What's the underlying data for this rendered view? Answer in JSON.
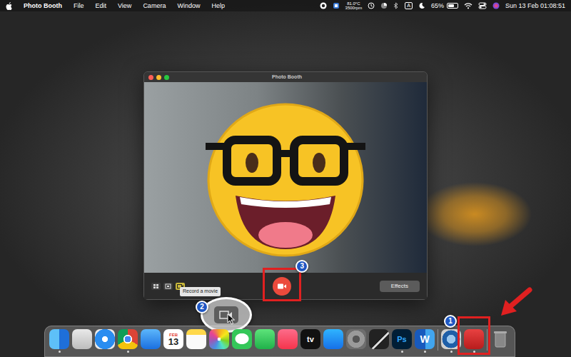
{
  "menubar": {
    "app": "Photo Booth",
    "menus": [
      "File",
      "Edit",
      "View",
      "Camera",
      "Window",
      "Help"
    ],
    "sensor": {
      "temp": "81.0°C",
      "fan": "3500rpm"
    },
    "input_source": "A",
    "battery": {
      "reading": "65%",
      "level": 0.65
    },
    "clock": "Sun 13 Feb  01:08:51"
  },
  "window": {
    "title": "Photo Booth",
    "view_modes": [
      {
        "kind": "grid",
        "selected": false
      },
      {
        "kind": "still",
        "selected": false
      },
      {
        "kind": "movie",
        "selected": true
      }
    ],
    "tooltip": "Record a movie",
    "effects_button": "Effects"
  },
  "dock": {
    "items": [
      {
        "running": true,
        "texts": []
      },
      {
        "running": false,
        "texts": []
      },
      {
        "running": false,
        "texts": []
      },
      {
        "running": true,
        "texts": []
      },
      {
        "running": false,
        "texts": []
      },
      {
        "running": false,
        "texts": [
          "FEB",
          "13"
        ]
      },
      {
        "running": false,
        "texts": []
      },
      {
        "running": false,
        "texts": []
      },
      {
        "running": false,
        "texts": []
      },
      {
        "running": false,
        "texts": []
      },
      {
        "running": false,
        "texts": []
      },
      {
        "running": false,
        "texts": [
          "tv"
        ]
      },
      {
        "running": false,
        "texts": []
      },
      {
        "running": false,
        "texts": []
      },
      {
        "running": false,
        "texts": []
      },
      {
        "running": true,
        "texts": [
          "Ps"
        ]
      },
      {
        "running": true,
        "texts": [
          "W"
        ]
      },
      {
        "running": true,
        "texts": []
      },
      {
        "running": true,
        "texts": []
      },
      {
        "running": false,
        "texts": []
      }
    ]
  },
  "callouts": [
    {
      "number": "1"
    },
    {
      "number": "2"
    },
    {
      "number": "3"
    }
  ]
}
